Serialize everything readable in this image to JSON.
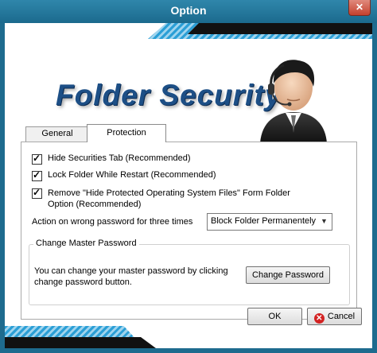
{
  "window": {
    "title": "Option",
    "close_glyph": "✕"
  },
  "logo": {
    "text": "Folder Security"
  },
  "tabs": [
    {
      "label": "General",
      "selected": false
    },
    {
      "label": "Protection",
      "selected": true
    }
  ],
  "options": [
    {
      "label": "Hide Securities Tab (Recommended)",
      "checked": true
    },
    {
      "label": "Lock Folder While Restart (Recommended)",
      "checked": true
    },
    {
      "label": "Remove \"Hide Protected Operating System Files\" Form Folder Option (Recommended)",
      "checked": true
    }
  ],
  "wrong_password": {
    "label": "Action on wrong password for three times",
    "selected": "Block Folder Permanentely"
  },
  "master_password": {
    "legend": "Change Master Password",
    "description": "You can change your master password by clicking change password button.",
    "button_label": "Change Password"
  },
  "footer": {
    "ok_label": "OK",
    "cancel_label": "Cancel"
  },
  "icons": {
    "close": "close-icon",
    "dropdown": "chevron-down-icon",
    "cancel": "cancel-icon",
    "avatar": "support-agent-icon"
  },
  "colors": {
    "titlebar": "#1b6a8d",
    "logo": "#1d4f86",
    "stripe": "#2b9fd6"
  }
}
